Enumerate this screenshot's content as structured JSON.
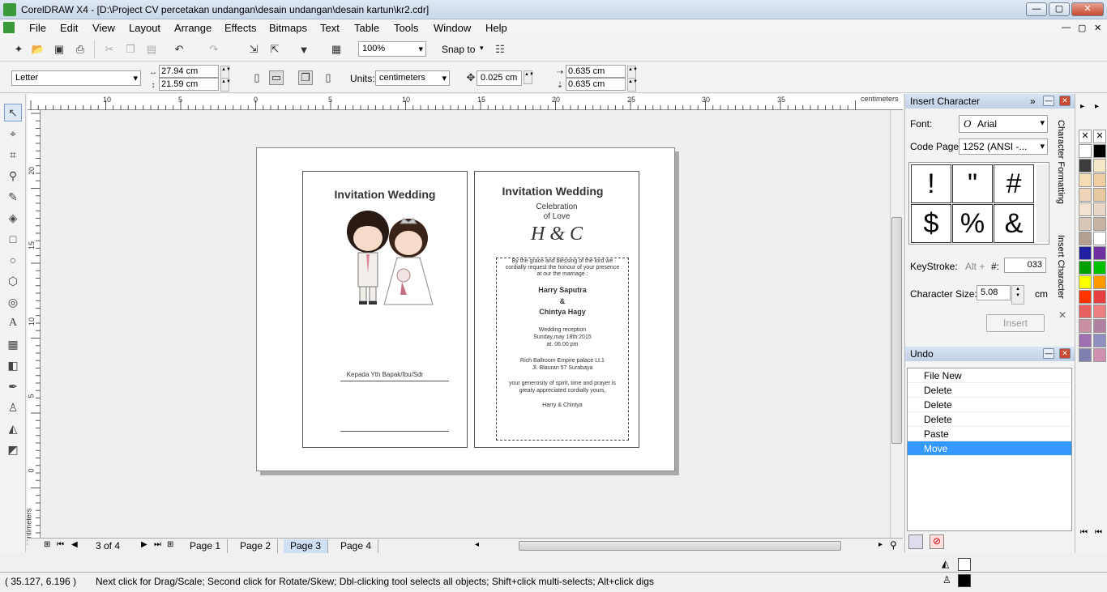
{
  "window": {
    "title": "CorelDRAW X4 - [D:\\Project CV percetakan undangan\\desain undangan\\desain kartun\\kr2.cdr]",
    "min": "—",
    "max": "▢",
    "close": "✕"
  },
  "menu": [
    "File",
    "Edit",
    "View",
    "Layout",
    "Arrange",
    "Effects",
    "Bitmaps",
    "Text",
    "Table",
    "Tools",
    "Window",
    "Help"
  ],
  "toolbar1": {
    "zoom": "100%",
    "snap": "Snap to"
  },
  "toolbar2": {
    "paper": "Letter",
    "width": "27.94 cm",
    "height": "21.59 cm",
    "units_label": "Units:",
    "units": "centimeters",
    "nudge": "0.025 cm",
    "dup_x": "0.635 cm",
    "dup_y": "0.635 cm"
  },
  "ruler": {
    "h_ticks": [
      "10",
      "5",
      "0",
      "5",
      "10",
      "15",
      "20",
      "25",
      "30",
      "35"
    ],
    "h_unit": "centimeters",
    "v_ticks": [
      "20",
      "15",
      "10",
      "5",
      "0"
    ],
    "v_unit": "centimeters"
  },
  "card_left": {
    "title": "Invitation Wedding",
    "to_label": "Kepada Yth Bapak/Ibu/Sdr"
  },
  "card_right": {
    "title": "Invitation Wedding",
    "sub1": "Celebration",
    "sub2": "of Love",
    "monogram": "H & C",
    "lines": [
      "By the grace and blessing of the lord we",
      "cordially request the honour of your presence",
      "at our the marriage :"
    ],
    "groom": "Harry Saputra",
    "amp": "&",
    "bride": "Chintya Hagy",
    "event": [
      "Wedding reception",
      "Sunday,may 18th 2015",
      "at. 06.00 pm"
    ],
    "venue": [
      "Rich Ballroom Empire palace Lt.1",
      "Jl. Blauran 57 Surabaya"
    ],
    "closing": [
      "your generosity of spirit, time and prayer is",
      "greaty appreciated cordially yours,"
    ],
    "sign": "Harry & Chintya"
  },
  "pages": {
    "counter": "3 of 4",
    "tabs": [
      "Page 1",
      "Page 2",
      "Page 3",
      "Page 4"
    ],
    "active": 2
  },
  "status": {
    "coords": "( 35.127, 6.196 )",
    "hint": "Next click for Drag/Scale; Second click for Rotate/Skew; Dbl-clicking tool selects all objects; Shift+click multi-selects; Alt+click digs"
  },
  "insert_char": {
    "title": "Insert Character",
    "font_label": "Font:",
    "font": "Arial",
    "codepage_label": "Code Page:",
    "codepage": "1252  (ANSI -...",
    "glyphs": [
      "!",
      "\"",
      "#",
      "$",
      "%",
      "&"
    ],
    "keystroke_label": "KeyStroke:",
    "alt": "Alt +",
    "hash": "#:",
    "code": "033",
    "size_label": "Character Size:",
    "size": "5.08",
    "unit": "cm",
    "insert": "Insert"
  },
  "undo": {
    "title": "Undo",
    "items": [
      "File New",
      "Delete",
      "Delete",
      "Delete",
      "Paste",
      "Move"
    ],
    "selected": 5
  },
  "side_tabs": [
    "Character Formatting",
    "Insert Character"
  ],
  "palette": [
    "#ffffff",
    "#000000",
    "#3c3c3c",
    "#f6e9c8",
    "#f4dcb4",
    "#efcfa2",
    "#eed5b7",
    "#e8c8a0",
    "#f2e2d0",
    "#e9d6c6",
    "#d9c7b8",
    "#c8b2a2",
    "#b4a090",
    "#ffffff",
    "#2020a0",
    "#7030a0",
    "#00a000",
    "#00c000",
    "#ffff00",
    "#ff9900",
    "#ff3300",
    "#e84040",
    "#e86060",
    "#ec8080",
    "#c890a0",
    "#b080a0",
    "#a070b0",
    "#9090c0",
    "#8080b0",
    "#d090b0"
  ]
}
